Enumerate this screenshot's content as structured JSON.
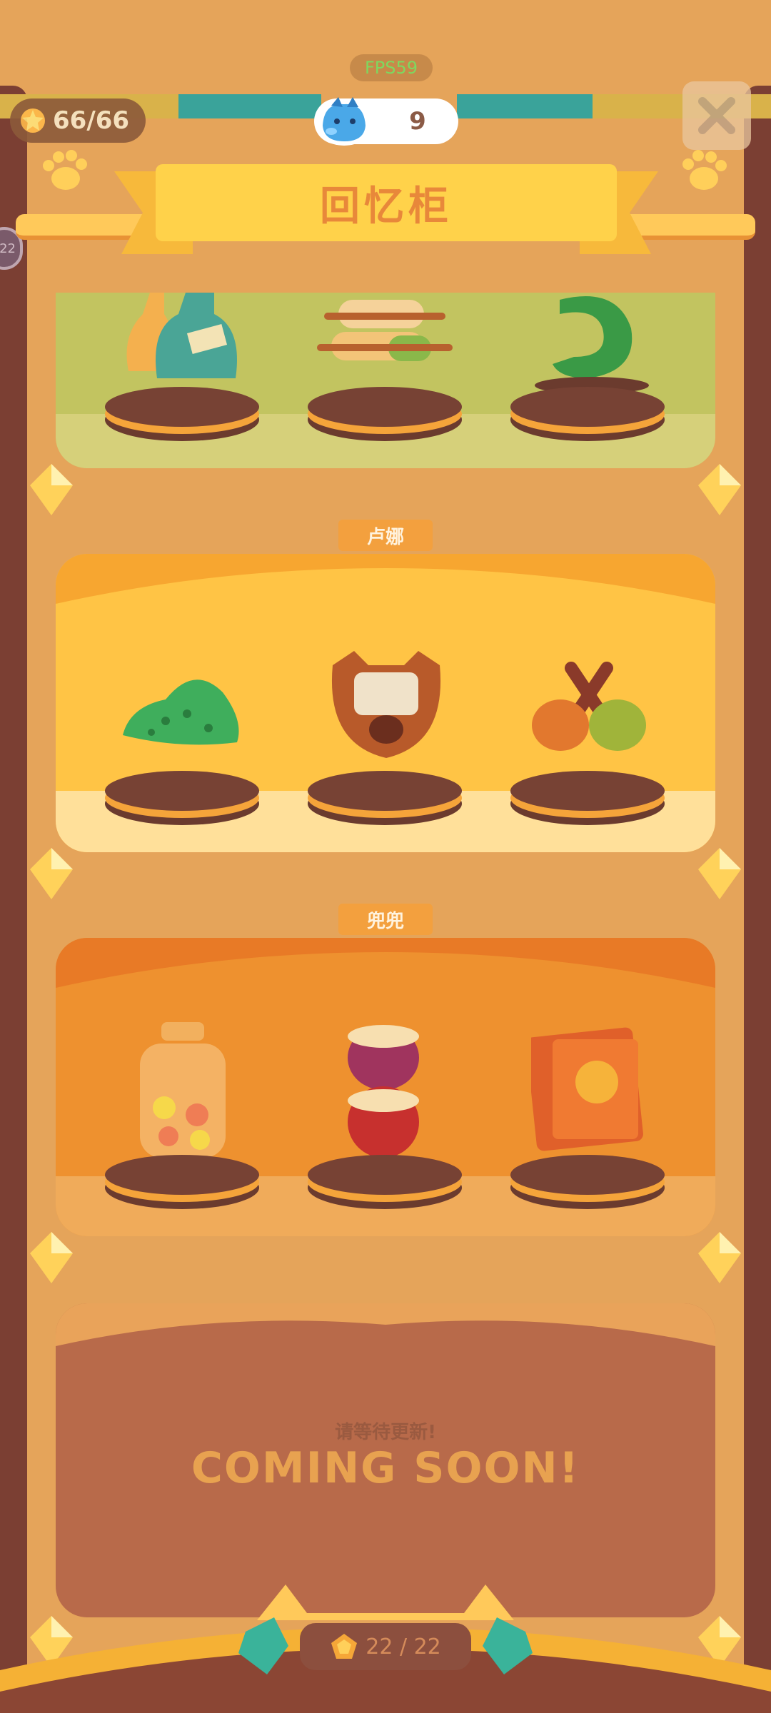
{
  "status": {
    "fps": "FPS59",
    "energy": "66/66",
    "gems": "9"
  },
  "header": {
    "title": "回忆柜"
  },
  "side_badge": "22",
  "shelves": [
    {
      "label": "",
      "items": [
        "bottles-icon",
        "scrolls-icon",
        "green-dragon-icon"
      ]
    },
    {
      "label": "卢娜",
      "items": [
        "green-slime-icon",
        "kalimba-icon",
        "maracas-icon"
      ]
    },
    {
      "label": "兜兜",
      "items": [
        "candy-jar-icon",
        "stacked-dolls-icon",
        "orange-book-icon"
      ]
    }
  ],
  "coming_soon": {
    "subtitle": "请等待更新!",
    "title": "COMING SOON!"
  },
  "footer": {
    "progress": "22 / 22"
  },
  "colors": {
    "background": "#e5a45a",
    "frame": "#7b3f33",
    "banner": "#ffd24a",
    "pedestal": "#6b3b2e"
  }
}
